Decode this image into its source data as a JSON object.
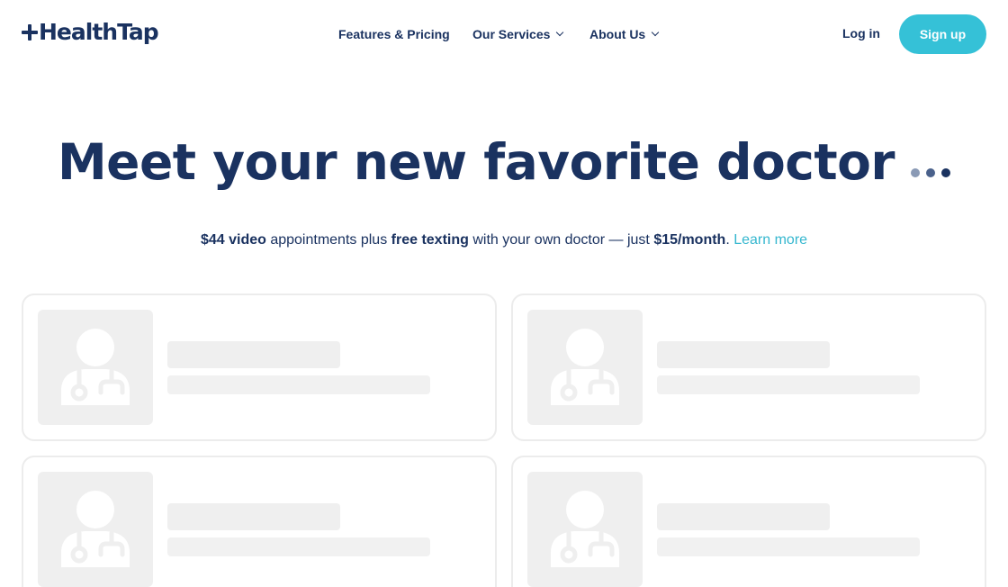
{
  "header": {
    "logo_text": "HealthTap",
    "nav": [
      {
        "label": "Features & Pricing",
        "has_dropdown": false
      },
      {
        "label": "Our Services",
        "has_dropdown": true
      },
      {
        "label": "About Us",
        "has_dropdown": true
      }
    ],
    "login_label": "Log in",
    "signup_label": "Sign up"
  },
  "hero": {
    "title": "Meet your new favorite doctor",
    "subline": {
      "part1_bold": "$44 video",
      "part2": " appointments plus ",
      "part3_bold": "free texting",
      "part4": " with your own doctor — just ",
      "part5_bold": "$15/month",
      "part6": ". ",
      "learn_more": "Learn more"
    }
  },
  "doctor_cards": {
    "count": 4,
    "state": "loading",
    "avatar_icon": "doctor-placeholder-icon"
  },
  "colors": {
    "brand_navy": "#1a3260",
    "accent_teal": "#35c1d7",
    "skeleton_gray": "#efefef"
  }
}
